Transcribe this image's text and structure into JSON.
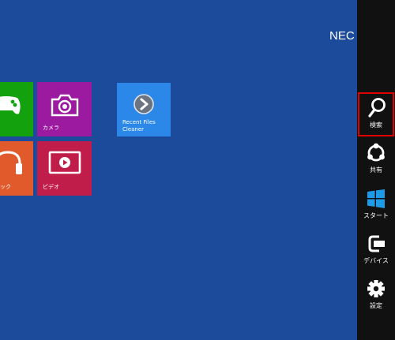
{
  "user": {
    "name": "NEC"
  },
  "tiles": {
    "games": {
      "label": "",
      "color": "#13a10e",
      "icon": "gamepad-icon"
    },
    "camera": {
      "label": "カメラ",
      "color": "#9b1aa0",
      "icon": "camera-icon"
    },
    "music": {
      "label": "ック",
      "color": "#e05a2b",
      "icon": "headphones-icon"
    },
    "video": {
      "label": "ビデオ",
      "color": "#c11d4b",
      "icon": "video-icon"
    },
    "recent_files": {
      "label_line1": "Recent Files",
      "label_line2": "Cleaner",
      "color": "#2b88e8",
      "icon": "arrow-right-circle-icon"
    }
  },
  "charms": [
    {
      "id": "search",
      "label": "検索",
      "icon": "search-icon",
      "selected": true
    },
    {
      "id": "share",
      "label": "共有",
      "icon": "share-icon",
      "selected": false
    },
    {
      "id": "start",
      "label": "スタート",
      "icon": "windows-logo-icon",
      "selected": false
    },
    {
      "id": "devices",
      "label": "デバイス",
      "icon": "devices-icon",
      "selected": false
    },
    {
      "id": "settings",
      "label": "設定",
      "icon": "gear-icon",
      "selected": false
    }
  ],
  "colors": {
    "background": "#1c4b9c",
    "charm_bar": "#111111",
    "highlight": "#e00000",
    "start_logo": "#1e9be8"
  }
}
